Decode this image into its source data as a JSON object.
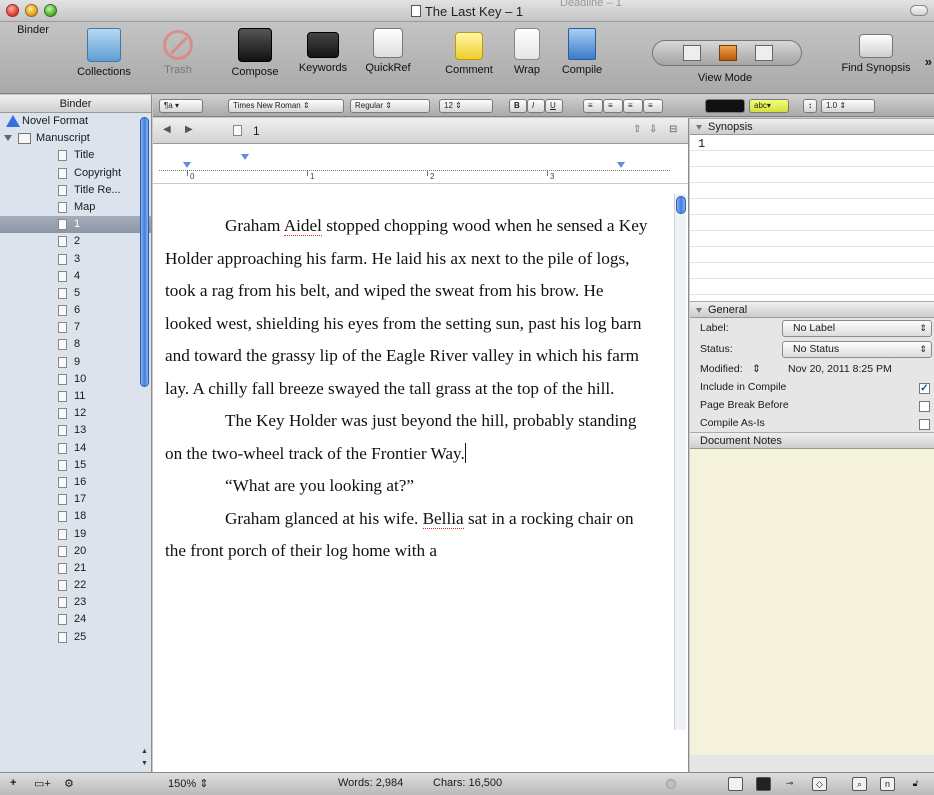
{
  "window": {
    "title": "The Last Key – 1",
    "ghost_title": "Deadline – 1"
  },
  "toolbar": {
    "binder": "Binder",
    "collections": "Collections",
    "trash": "Trash",
    "compose": "Compose",
    "keywords": "Keywords",
    "quickref": "QuickRef",
    "comment": "Comment",
    "wrap": "Wrap",
    "compile": "Compile",
    "view_mode": "View Mode",
    "find_synopsis": "Find Synopsis"
  },
  "binder": {
    "heading": "Binder",
    "items": [
      "Novel Format",
      "Manuscript",
      "Title",
      "Copyright",
      "Title Re...",
      "Map",
      "1",
      "2",
      "3",
      "4",
      "5",
      "6",
      "7",
      "8",
      "9",
      "10",
      "11",
      "12",
      "13",
      "14",
      "15",
      "16",
      "17",
      "18",
      "19",
      "20",
      "21",
      "22",
      "23",
      "24",
      "25"
    ],
    "selected": "1"
  },
  "format_bar": {
    "paragraph": "¶a",
    "font": "Times New Roman",
    "style": "Regular",
    "size": "12",
    "bold": "B",
    "italic": "I",
    "underline": "U",
    "highlight": "abc",
    "line_spacing": "1.0"
  },
  "editor": {
    "doc_title": "1",
    "ruler_numbers": [
      "0",
      "1",
      "2",
      "3"
    ],
    "p1_a": "Graham ",
    "p1_spell": "Aidel",
    "p1_b": " stopped chopping wood when he sensed a Key Holder approaching his farm.  He laid his ax next to the pile of logs, took a rag from his belt, and wiped the sweat from his brow.  He looked west, shielding his eyes from the setting sun, past his log barn and toward the grassy lip of the Eagle River valley in which his farm lay.  A chilly fall breeze swayed the tall grass at the top of the hill.",
    "p2": "The Key Holder was just beyond the hill, probably standing on the two-wheel track of the Frontier Way.",
    "p3": "“What are you looking at?”",
    "p4_a": "Graham glanced at his wife.  ",
    "p4_spell": "Bellia",
    "p4_b": " sat in a rocking chair on the front porch of their log home with a"
  },
  "inspector": {
    "synopsis_label": "Synopsis",
    "synopsis_text": "1",
    "general_label": "General",
    "label_key": "Label:",
    "label_value": "No Label",
    "status_key": "Status:",
    "status_value": "No Status",
    "modified_key": "Modified:",
    "modified_value": "Nov 20, 2011 8:25 PM",
    "include_in_compile": "Include in Compile",
    "include_checked": true,
    "page_break_before": "Page Break Before",
    "compile_as_is": "Compile As-Is",
    "notes_label": "Document Notes"
  },
  "footer": {
    "zoom": "150%",
    "words": "Words: 2,984",
    "chars": "Chars: 16,500",
    "add": "+",
    "add_folder": "▭+",
    "gear": "⚙"
  },
  "colors": {
    "selection": "#8d96a5",
    "scroll_accent": "#3f7fe0",
    "notes_bg": "#f5f2dc"
  }
}
